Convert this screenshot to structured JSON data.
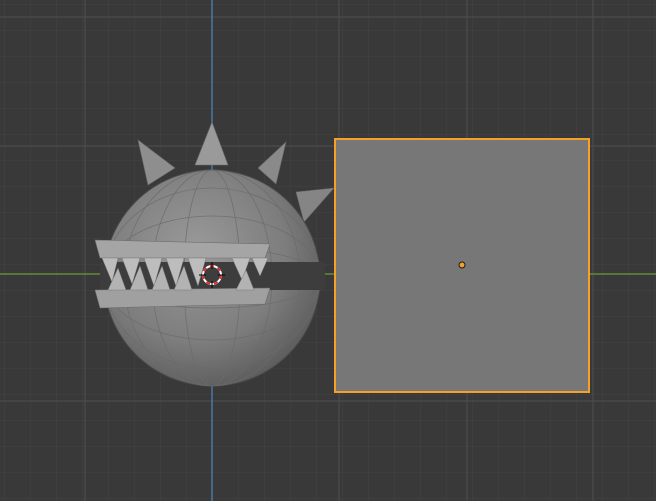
{
  "viewport": {
    "background_color": "#393939",
    "grid_minor_color": "#434343",
    "grid_major_color": "#4f4f4f",
    "x_axis_color": "#6d9b3a",
    "y_axis_color": "#4f7fb8",
    "selection_outline_color": "#f5a029",
    "origin_dot_color": "#f5a029",
    "cursor_colors": [
      "#e62b2b",
      "#ffffff"
    ]
  },
  "scene": {
    "objects": [
      {
        "name": "spiked-ball-mesh",
        "kind": "mesh",
        "selected": false,
        "icon": "spiked-chomper-mesh"
      },
      {
        "name": "cube-mesh",
        "kind": "mesh",
        "selected": true,
        "icon": "square-plane-mesh"
      }
    ],
    "cursor_icon": "3d-cursor-icon"
  }
}
